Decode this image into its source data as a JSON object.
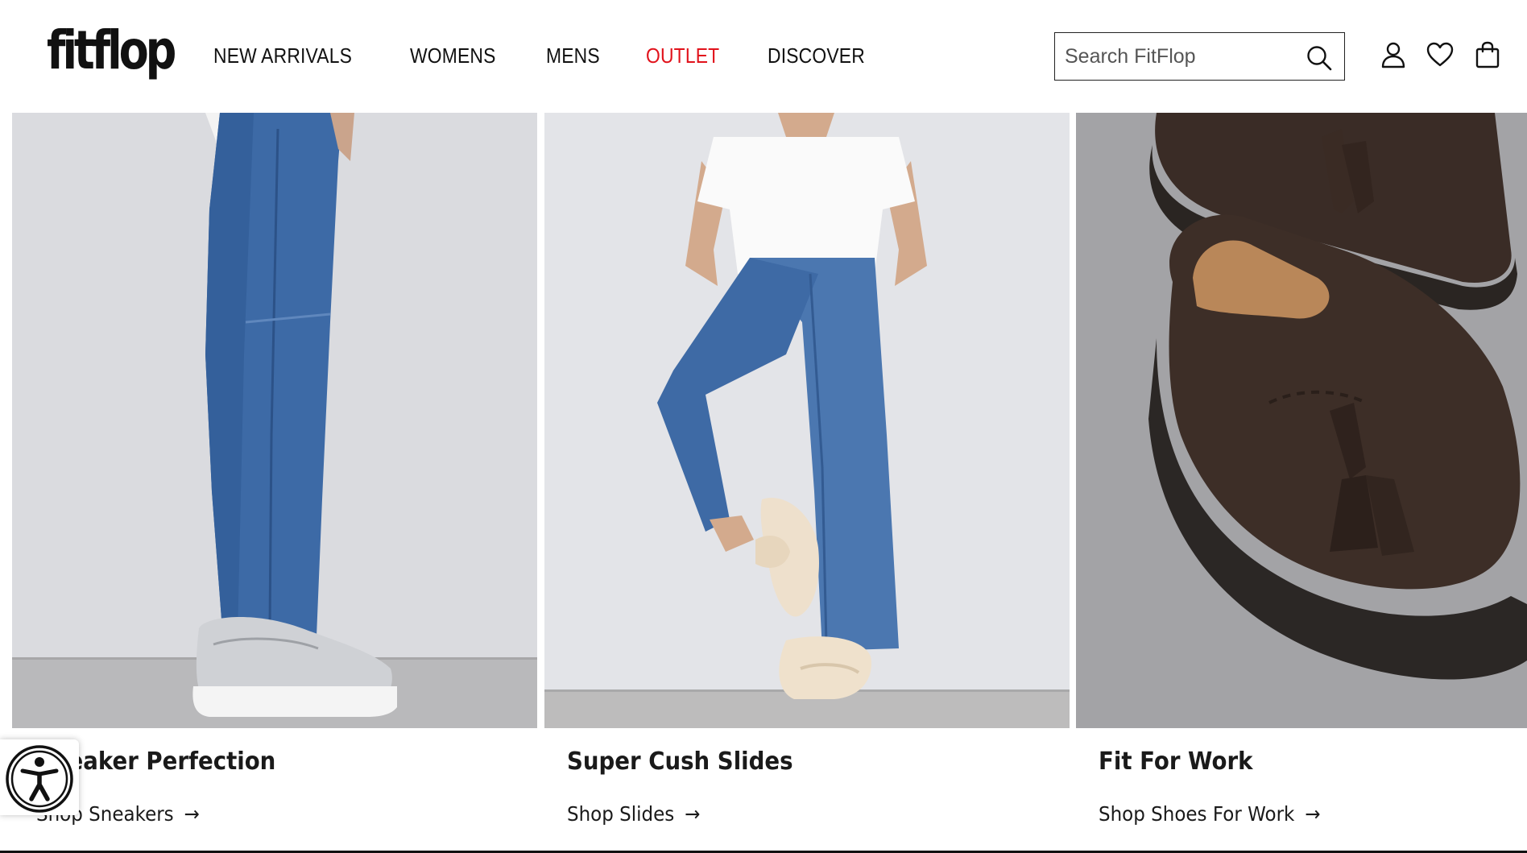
{
  "header": {
    "logo": "fitflop",
    "nav": [
      {
        "label": "NEW ARRIVALS"
      },
      {
        "label": "WOMENS"
      },
      {
        "label": "MENS"
      },
      {
        "label": "OUTLET"
      },
      {
        "label": "DISCOVER"
      }
    ],
    "search": {
      "placeholder": "Search FitFlop"
    },
    "icons": [
      "search-icon",
      "account-icon",
      "wishlist-heart-icon",
      "bag-icon"
    ],
    "outlet_color": "#e1121b"
  },
  "tiles": [
    {
      "title": "Sneaker Perfection",
      "link": "Shop Sneakers",
      "arrow": "→"
    },
    {
      "title": "Super Cush Slides",
      "link": "Shop Slides",
      "arrow": "→"
    },
    {
      "title": "Fit For Work",
      "link": "Shop Shoes For Work",
      "arrow": "→"
    }
  ],
  "accessibility": {
    "icon": "accessibility-icon"
  }
}
